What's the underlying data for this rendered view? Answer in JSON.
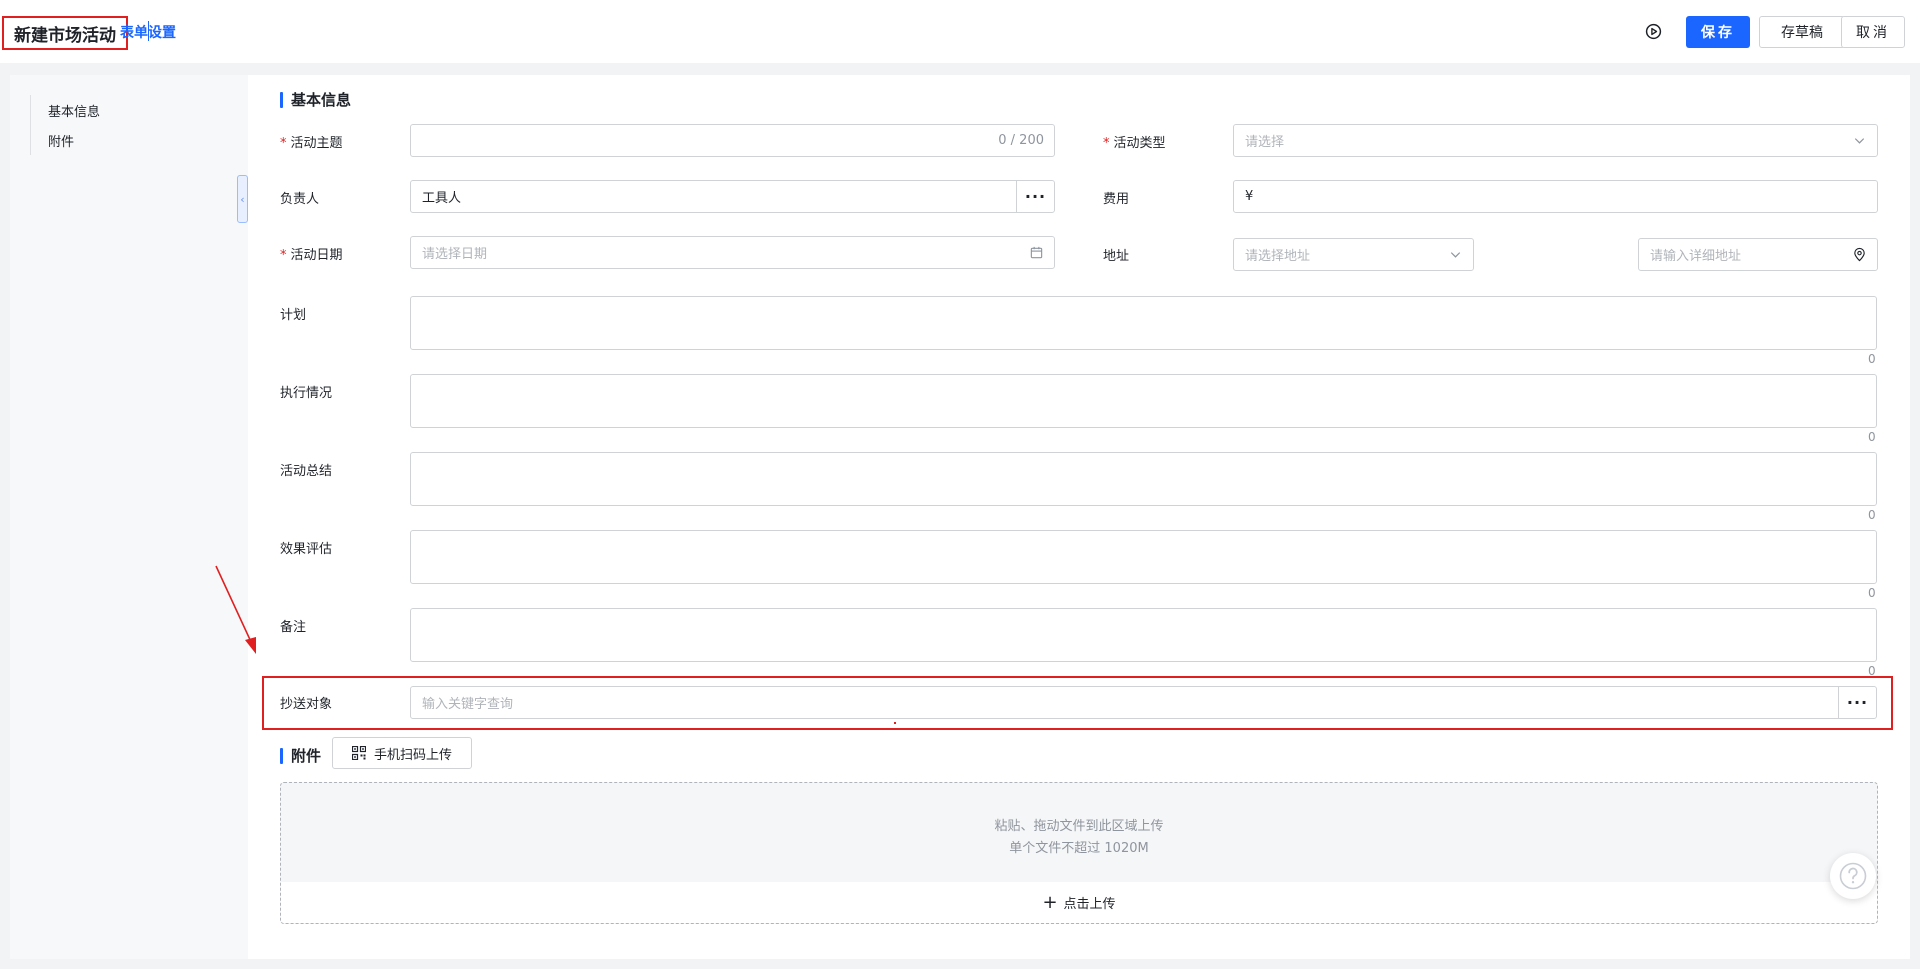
{
  "header": {
    "title": "新建市场活动",
    "form_settings": "表单设置",
    "preview_icon": "play-circle-icon",
    "save": "保存",
    "draft": "存草稿",
    "cancel": "取消"
  },
  "nav": {
    "items": [
      {
        "label": "基本信息"
      },
      {
        "label": "附件"
      }
    ]
  },
  "basic_section": {
    "title": "基本信息",
    "fields": {
      "topic": {
        "label": "活动主题",
        "required": true,
        "value": "",
        "counter": "0 / 200"
      },
      "type": {
        "label": "活动类型",
        "required": true,
        "placeholder": "请选择"
      },
      "owner": {
        "label": "负责人",
        "value": "工具人"
      },
      "cost": {
        "label": "费用",
        "prefix": "¥",
        "value": ""
      },
      "date": {
        "label": "活动日期",
        "required": true,
        "placeholder": "请选择日期"
      },
      "address": {
        "label": "地址",
        "region_placeholder": "请选择地址",
        "detail_placeholder": "请输入详细地址"
      },
      "plan": {
        "label": "计划",
        "count": "0"
      },
      "execution": {
        "label": "执行情况",
        "count": "0"
      },
      "summary": {
        "label": "活动总结",
        "count": "0"
      },
      "evaluation": {
        "label": "效果评估",
        "count": "0"
      },
      "remark": {
        "label": "备注",
        "count": "0"
      },
      "cc": {
        "label": "抄送对象",
        "placeholder": "输入关键字查询"
      }
    }
  },
  "attachments": {
    "title": "附件",
    "scan_button": "手机扫码上传",
    "hint_line1": "粘贴、拖动文件到此区域上传",
    "hint_line2": "单个文件不超过 1020M",
    "upload_label": "点击上传"
  },
  "colors": {
    "primary": "#1a66ff",
    "highlight": "#e02020",
    "border": "#d0d3d6"
  }
}
